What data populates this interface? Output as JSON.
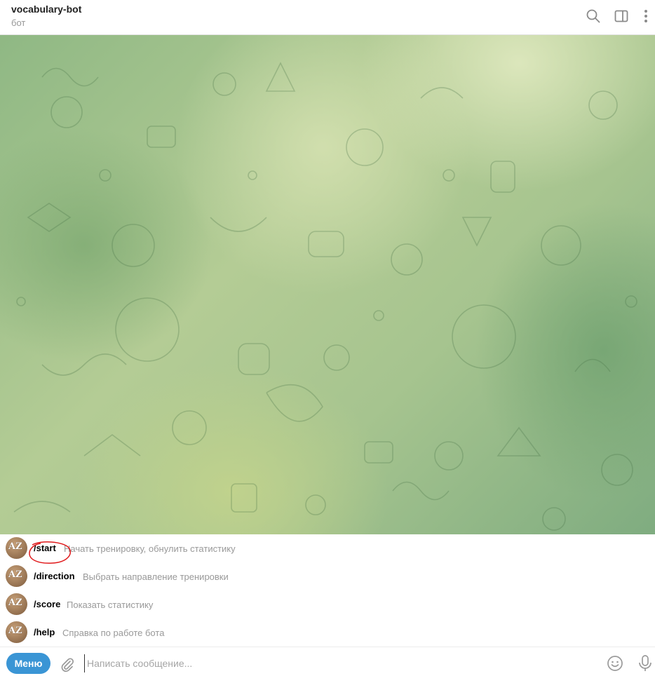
{
  "header": {
    "title": "vocabulary-bot",
    "subtitle": "бот",
    "icons": [
      "search-icon",
      "sidebar-toggle-icon",
      "more-vertical-icon"
    ]
  },
  "commands": [
    {
      "name": "/start",
      "description": "Начать тренировку, обнулить статистику",
      "avatar_text": "AZ"
    },
    {
      "name": "/direction",
      "description": "Выбрать направление тренировки",
      "avatar_text": "AZ"
    },
    {
      "name": "/score",
      "description": "Показать статистику",
      "avatar_text": "AZ"
    },
    {
      "name": "/help",
      "description": "Справка по работе бота",
      "avatar_text": "AZ"
    }
  ],
  "annotation": {
    "color": "#e0191b",
    "target": "/start"
  },
  "input": {
    "menu_label": "Меню",
    "placeholder": "Написать сообщение...",
    "value": ""
  },
  "colors": {
    "accent": "#3a95d5",
    "background_green": "#a6c48f"
  }
}
